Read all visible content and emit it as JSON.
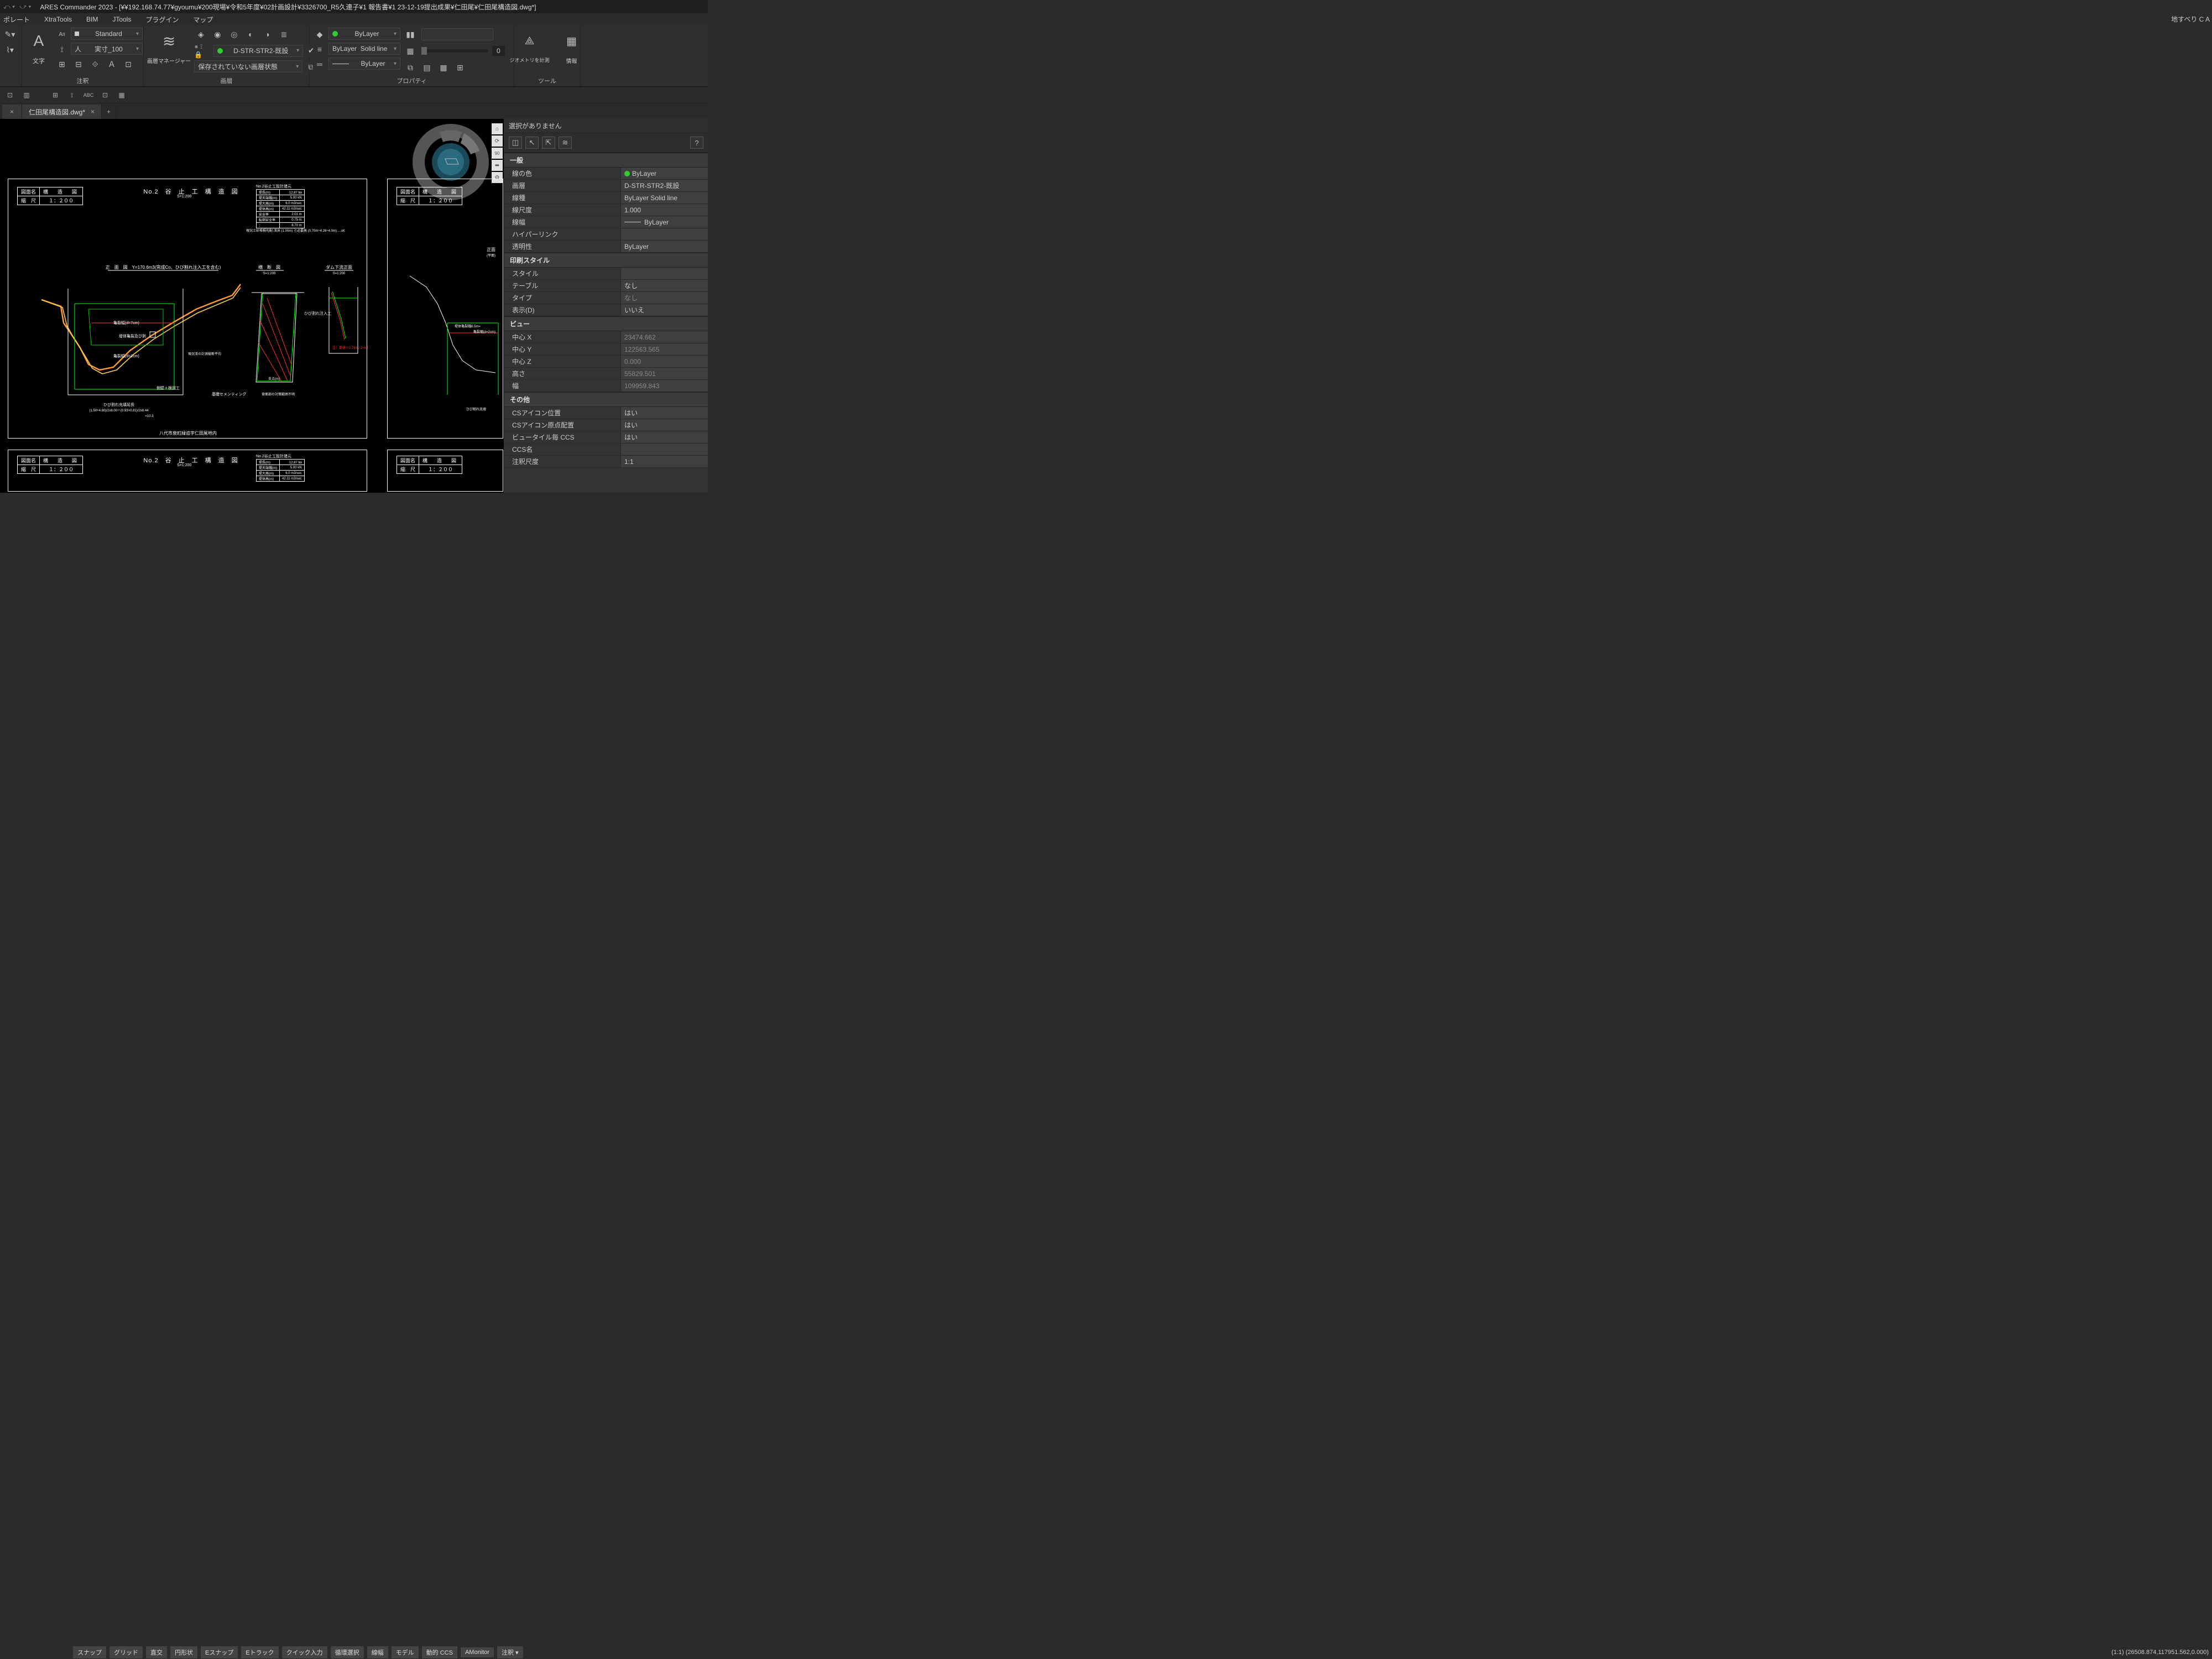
{
  "titlebar": {
    "app": "ARES Commander 2023",
    "doc": "[¥¥192.168.74.77¥gyoumu¥200現場¥令和5年度¥02計画設計¥3326700_R5久連子¥1 報告書¥1 23-12-19提出成果¥仁田尾¥仁田尾構造図.dwg*]"
  },
  "menubar": {
    "items": [
      "ポレート",
      "XtraTools",
      "BIM",
      "JTools",
      "プラグイン",
      "マップ"
    ]
  },
  "topright": "地すべり C A",
  "ribbon": {
    "annot": {
      "label": "注釈",
      "style_label": "Standard",
      "dim_label": "実寸_100",
      "moji": "文字"
    },
    "layer": {
      "label": "画層",
      "manager": "画層マネージャー",
      "active": "D-STR-STR2-既設",
      "state": "保存されていない画層状態"
    },
    "prop": {
      "label": "プロパティ",
      "color": "ByLayer",
      "ltype1": "ByLayer",
      "ltype2": "Solid line",
      "ltype3": "ByLayer",
      "opacity": "0"
    },
    "tool": {
      "label": "ツール",
      "geom": "ジオメトリを計測",
      "info": "情報"
    }
  },
  "tabs": {
    "active": "仁田尾構造図.dwg*",
    "close": "×",
    "plus": "+"
  },
  "viewport_toolbar": {
    "home": "⌂",
    "rot": "⟳",
    "ninety": "90",
    "pan": "⬌",
    "gear": "⚙"
  },
  "sheet": {
    "title_table": {
      "r1c1": "図面名",
      "r1c2": "構　造　図",
      "r2c1": "縮　尺",
      "r2c2": "１：２００"
    },
    "drawing_title": "No.2　谷　止　工　構　造　図",
    "drawing_sub": "S=1:200",
    "spec_title": "No.2谷止工設計諸元",
    "spec": [
      [
        "堤長(m)",
        "12.87 ㎞"
      ],
      [
        "堤天端幅(m)",
        "5.00 kN"
      ],
      [
        "堤大高(m)",
        "6.0 m3/sec"
      ],
      [
        "堤体高(m)",
        "42.11 m3/sec"
      ],
      [
        "安全率",
        "2.01 m"
      ],
      [
        "転倒安全率",
        "0.75 m"
      ],
      [
        "：",
        "8.70 m"
      ]
    ],
    "spec_foot": "現況土砂堆積勾配-渓床 (1.00m) ≧必要高 (0.70m÷4.26÷4.0m) …oK",
    "elev_title": "正　面　図　Y=170.6m3(完成Co、ひび割れ注入工を含む)",
    "cross_title": "横　断　図",
    "cross_sub": "S=1:200",
    "dam_title": "ダム下流正面",
    "dam_sub": "S=1:200",
    "labels": {
      "crack7": "亀裂幅(d=7cm)",
      "crack1": "亀裂幅(d=1cm)",
      "body": "堤体亀裂及び剥",
      "hibi": "ひび割れ注入工",
      "kiso": "基礎セメンティング",
      "sokuheki": "側壁＋根固工",
      "hibi_len": "ひび割れ充填延長",
      "hibi_calc": "(1.50+4.80)/2x8.00＝(0.93+0.81)/2x6.44",
      "equals": "=10.3",
      "yatsushiro": "八代市泉町緑追字仁田尾地内",
      "keisoku": "現況渓の計測縦断平均",
      "shiten": "支点(m)",
      "taisaku": "背面部の対策範囲不明",
      "crack2": "亀裂幅(d=2cm)",
      "crack_l": "堤体亀裂幅6.5m=",
      "elev_r": "正面",
      "hibi2": "ひび割れ充填"
    }
  },
  "properties": {
    "header": "選択がありません",
    "sections": {
      "general": {
        "title": "一般",
        "rows": [
          {
            "k": "線の色",
            "v": "ByLayer",
            "dot": true
          },
          {
            "k": "画層",
            "v": "D-STR-STR2-既設"
          },
          {
            "k": "線種",
            "v": "ByLayer    Solid line"
          },
          {
            "k": "線尺度",
            "v": "1.000"
          },
          {
            "k": "線幅",
            "v": "ByLayer",
            "line": true
          },
          {
            "k": "ハイパーリンク",
            "v": ""
          },
          {
            "k": "透明性",
            "v": "ByLayer"
          }
        ]
      },
      "printstyle": {
        "title": "印刷スタイル",
        "rows": [
          {
            "k": "スタイル",
            "v": ""
          },
          {
            "k": "テーブル",
            "v": "なし"
          },
          {
            "k": "タイプ",
            "v": "なし",
            "dim": true
          },
          {
            "k": "表示(D)",
            "v": "いいえ"
          }
        ]
      },
      "view": {
        "title": "ビュー",
        "rows": [
          {
            "k": "中心 X",
            "v": "23474.662",
            "dim": true
          },
          {
            "k": "中心 Y",
            "v": "122563.565",
            "dim": true
          },
          {
            "k": "中心 Z",
            "v": "0.000",
            "dim": true
          },
          {
            "k": "高さ",
            "v": "55829.501",
            "dim": true
          },
          {
            "k": "幅",
            "v": "109959.843",
            "dim": true
          }
        ]
      },
      "other": {
        "title": "その他",
        "rows": [
          {
            "k": "CSアイコン位置",
            "v": "はい"
          },
          {
            "k": "CSアイコン原点配置",
            "v": "はい"
          },
          {
            "k": "ビュータイル毎 CCS",
            "v": "はい"
          },
          {
            "k": "CCS名",
            "v": ""
          },
          {
            "k": "注釈尺度",
            "v": "1:1"
          }
        ]
      }
    }
  },
  "statusbar": {
    "buttons": [
      "スナップ",
      "グリッド",
      "直交",
      "円形状",
      "Eスナップ",
      "Eトラック",
      "クイック入力",
      "循環選択",
      "線幅",
      "モデル",
      "動的 CCS",
      "AMonitor",
      "注釈 ▾"
    ],
    "coords": "(1:1)  (26508.874,117951.562,0.000)"
  }
}
